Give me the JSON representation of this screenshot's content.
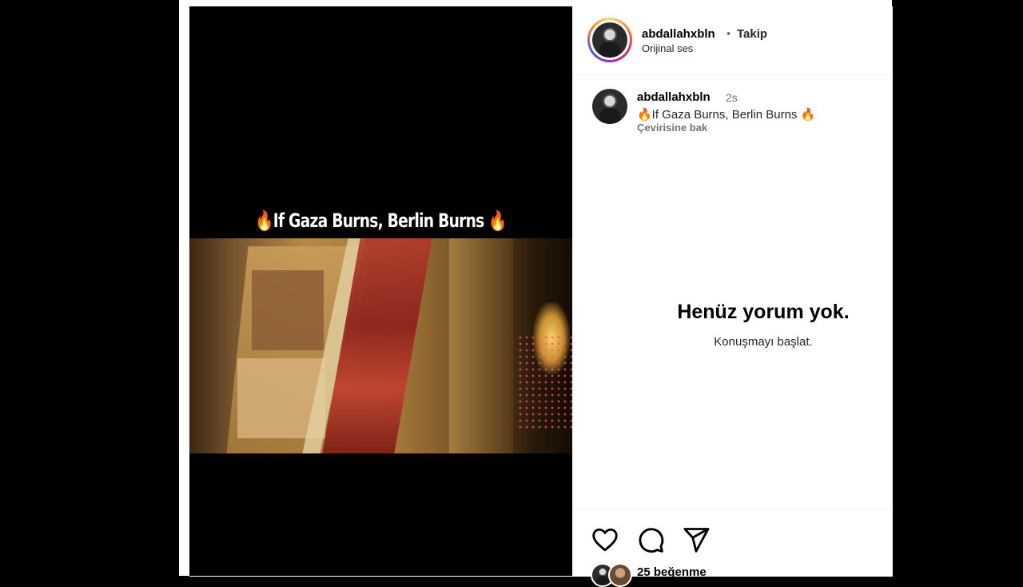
{
  "video": {
    "overlay_caption": "🔥If Gaza Burns, Berlin Burns 🔥"
  },
  "header": {
    "username": "abdallahxbln",
    "separator": "•",
    "follow_label": "Takip",
    "audio_label": "Orijinal ses"
  },
  "caption": {
    "username": "abdallahxbln",
    "time": "2s",
    "text": "🔥If Gaza Burns, Berlin Burns 🔥",
    "translate_label": "Çevirisine bak"
  },
  "comments": {
    "empty_title": "Henüz yorum yok.",
    "empty_subtitle": "Konuşmayı başlat."
  },
  "actions": {
    "like_icon": "heart-icon",
    "comment_icon": "comment-icon",
    "share_icon": "share-icon",
    "likes_label": "25 beğenme"
  }
}
